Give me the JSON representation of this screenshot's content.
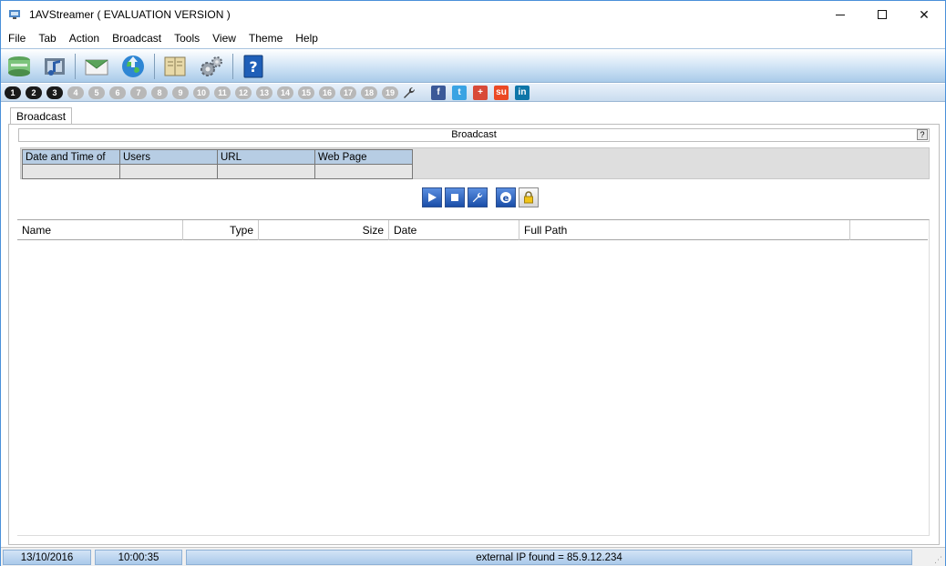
{
  "window": {
    "title": "1AVStreamer ( EVALUATION VERSION )"
  },
  "menu": [
    "File",
    "Tab",
    "Action",
    "Broadcast",
    "Tools",
    "View",
    "Theme",
    "Help"
  ],
  "toolbar": {
    "buttons": [
      "storage-icon",
      "media-icon",
      "mail-icon",
      "globe-icon",
      "book-icon",
      "gears-icon",
      "help-book-icon"
    ]
  },
  "tabs": {
    "numbers": [
      "1",
      "2",
      "3",
      "4",
      "5",
      "6",
      "7",
      "8",
      "9",
      "10",
      "11",
      "12",
      "13",
      "14",
      "15",
      "16",
      "17",
      "18",
      "19"
    ],
    "active_count": 3,
    "social": [
      {
        "name": "facebook-icon",
        "glyph": "f",
        "color": "#3b5998"
      },
      {
        "name": "twitter-icon",
        "glyph": "t",
        "color": "#3aa3e3"
      },
      {
        "name": "google-plus-icon",
        "glyph": "+",
        "color": "#d84a38"
      },
      {
        "name": "stumbleupon-icon",
        "glyph": "su",
        "color": "#eb4924"
      },
      {
        "name": "linkedin-icon",
        "glyph": "in",
        "color": "#0e76a8"
      }
    ]
  },
  "doc_tab": {
    "label": "Broadcast"
  },
  "broadcast": {
    "header": "Broadcast",
    "help": "?",
    "columns": [
      "Date and Time of",
      "Users",
      "URL",
      "Web Page"
    ]
  },
  "files": {
    "columns": [
      "Name",
      "Type",
      "Size",
      "Date",
      "Full Path"
    ]
  },
  "status": {
    "date": "13/10/2016",
    "time": "10:00:35",
    "message": "external IP found = 85.9.12.234"
  }
}
